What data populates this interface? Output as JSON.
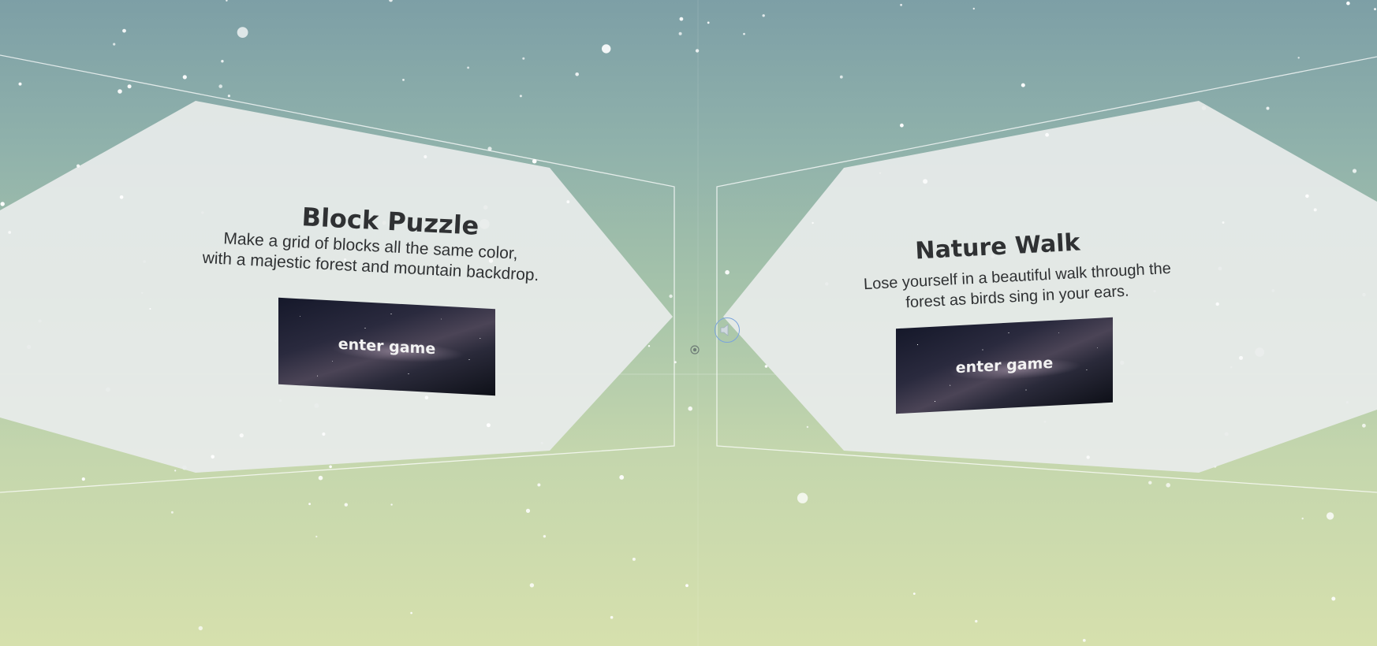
{
  "panels": [
    {
      "title": "Block Puzzle",
      "description_line1": "Make a grid of blocks all the same color,",
      "description_line2": "with a majestic forest and mountain backdrop.",
      "button_label": "enter game"
    },
    {
      "title": "Nature Walk",
      "description_line1": "Lose yourself in a beautiful walk through the",
      "description_line2": "forest as birds sing in your ears.",
      "button_label": "enter game"
    }
  ],
  "icons": {
    "audio": "speaker-icon",
    "cursor": "gaze-reticle-icon"
  },
  "colors": {
    "sky_top": "#7d9fa6",
    "ground_bottom": "#d6e0ad",
    "panel_fill": "#e8ecea",
    "text": "#2f3133",
    "audio_ring": "#7aa4dc"
  }
}
